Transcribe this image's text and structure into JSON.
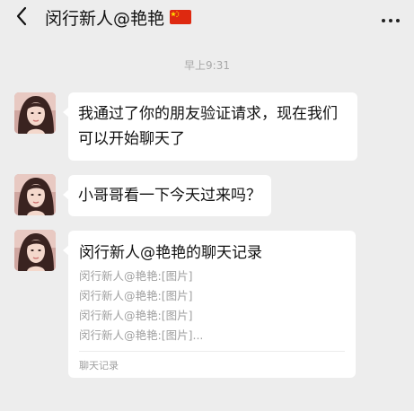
{
  "header": {
    "title": "闵行新人@艳艳",
    "back_icon": "chevron-left-icon",
    "flag_icon": "china-flag-icon",
    "more_icon": "more-dots-icon"
  },
  "timestamp": "早上9:31",
  "messages": [
    {
      "text": "我通过了你的朋友验证请求，现在我们可以开始聊天了"
    },
    {
      "text": "小哥哥看一下今天过来吗？"
    }
  ],
  "chat_record": {
    "title": "闵行新人@艳艳的聊天记录",
    "lines": [
      "闵行新人@艳艳:[图片]",
      "闵行新人@艳艳:[图片]",
      "闵行新人@艳艳:[图片]",
      "闵行新人@艳艳:[图片]..."
    ],
    "footer": "聊天记录"
  },
  "colors": {
    "background": "#ededed",
    "bubble": "#ffffff",
    "flag_red": "#de2910",
    "flag_yellow": "#ffde00"
  }
}
